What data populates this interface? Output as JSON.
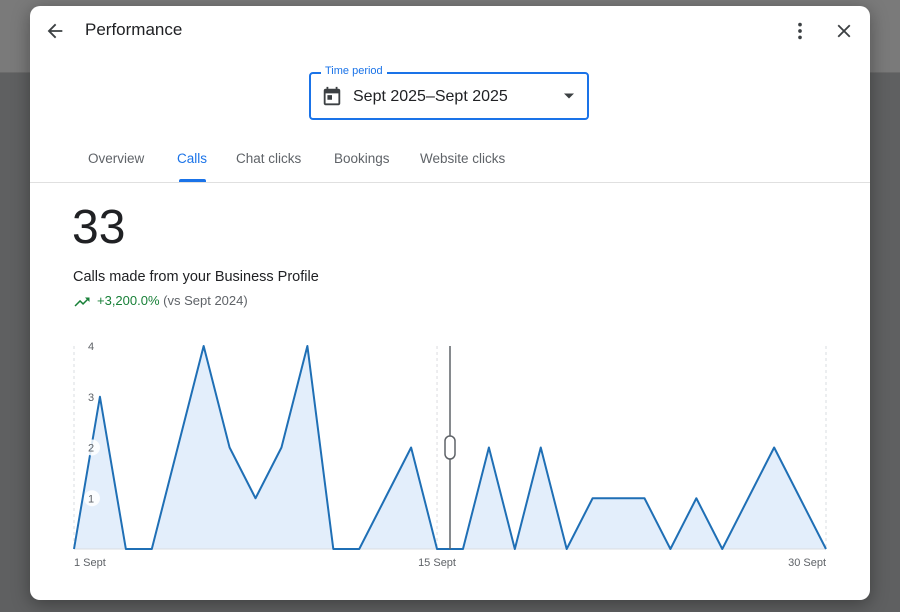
{
  "dialog": {
    "title": "Performance",
    "time_period": {
      "label": "Time period",
      "value": "Sept 2025–Sept 2025"
    },
    "tabs": [
      {
        "label": "Overview",
        "active": false
      },
      {
        "label": "Calls",
        "active": true
      },
      {
        "label": "Chat clicks",
        "active": false
      },
      {
        "label": "Bookings",
        "active": false
      },
      {
        "label": "Website clicks",
        "active": false
      }
    ],
    "metric": {
      "value": "33",
      "description": "Calls made from your Business Profile",
      "change": "+3,200.0%",
      "comparison": "(vs Sept 2024)"
    }
  },
  "colors": {
    "accent": "#1a73e8",
    "positive": "#188038",
    "series_line": "#1f6fb5",
    "series_fill": "#e3eefb"
  },
  "icons": [
    "back-arrow-icon",
    "more-vert-icon",
    "close-icon",
    "calendar-icon",
    "dropdown-caret-icon",
    "trending-up-icon"
  ],
  "chart_data": {
    "type": "area",
    "x": [
      "1 Sept",
      "2 Sept",
      "3 Sept",
      "4 Sept",
      "5 Sept",
      "6 Sept",
      "7 Sept",
      "8 Sept",
      "9 Sept",
      "10 Sept",
      "11 Sept",
      "12 Sept",
      "13 Sept",
      "14 Sept",
      "15 Sept",
      "16 Sept",
      "17 Sept",
      "18 Sept",
      "19 Sept",
      "20 Sept",
      "21 Sept",
      "22 Sept",
      "23 Sept",
      "24 Sept",
      "25 Sept",
      "26 Sept",
      "27 Sept",
      "28 Sept",
      "29 Sept",
      "30 Sept"
    ],
    "values": [
      0,
      3,
      0,
      0,
      2,
      4,
      2,
      1,
      2,
      4,
      0,
      0,
      1,
      2,
      0,
      0,
      2,
      0,
      2,
      0,
      1,
      1,
      1,
      0,
      1,
      0,
      1,
      2,
      1,
      0
    ],
    "x_tick_labels": [
      "1 Sept",
      "15 Sept",
      "30 Sept"
    ],
    "x_tick_indices": [
      0,
      14,
      29
    ],
    "y_ticks": [
      1,
      2,
      3,
      4
    ],
    "ylim": [
      0,
      4
    ],
    "grid": false,
    "cursor_index": 14.5
  }
}
